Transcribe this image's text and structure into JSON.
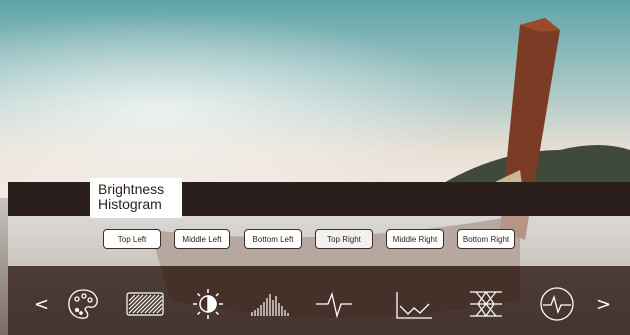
{
  "panel": {
    "title_line1": "Brightness",
    "title_line2": "Histogram"
  },
  "positions": [
    {
      "label": "Top Left"
    },
    {
      "label": "Middle Left"
    },
    {
      "label": "Bottom Left"
    },
    {
      "label": "Top Right",
      "selected": true
    },
    {
      "label": "Middle Right"
    },
    {
      "label": "Bottom Right"
    }
  ],
  "toolbar": {
    "prev_label": "<",
    "next_label": ">",
    "tools": [
      "palette-icon",
      "hatched-pattern-icon",
      "brightness-icon",
      "histogram-icon",
      "waveform-icon",
      "line-graph-icon",
      "vectorscope-icon",
      "heartbeat-circle-icon"
    ]
  },
  "colors": {
    "band": "#2a1f1c",
    "toolbar": "#3a2822",
    "icon": "#ffffff"
  }
}
